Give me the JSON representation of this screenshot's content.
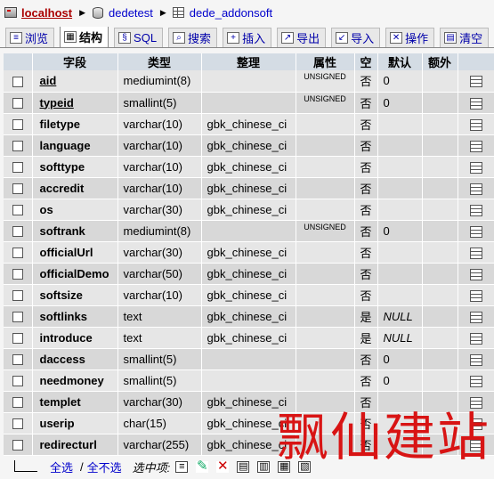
{
  "breadcrumb": {
    "server": "localhost",
    "database": "dedetest",
    "table": "dede_addonsoft"
  },
  "tabs": [
    {
      "label": "浏览",
      "icon": "browse-icon"
    },
    {
      "label": "结构",
      "icon": "structure-icon",
      "active": true
    },
    {
      "label": "SQL",
      "icon": "sql-icon"
    },
    {
      "label": "搜索",
      "icon": "search-icon"
    },
    {
      "label": "插入",
      "icon": "insert-icon"
    },
    {
      "label": "导出",
      "icon": "export-icon"
    },
    {
      "label": "导入",
      "icon": "import-icon"
    },
    {
      "label": "操作",
      "icon": "operations-icon"
    },
    {
      "label": "清空",
      "icon": "empty-icon"
    }
  ],
  "table": {
    "headers": [
      "字段",
      "类型",
      "整理",
      "属性",
      "空",
      "默认",
      "额外"
    ],
    "rows": [
      {
        "field": "aid",
        "type": "mediumint(8)",
        "collation": "",
        "attributes": "UNSIGNED",
        "null": "否",
        "default": "0",
        "extra": ""
      },
      {
        "field": "typeid",
        "type": "smallint(5)",
        "collation": "",
        "attributes": "UNSIGNED",
        "null": "否",
        "default": "0",
        "extra": ""
      },
      {
        "field": "filetype",
        "type": "varchar(10)",
        "collation": "gbk_chinese_ci",
        "attributes": "",
        "null": "否",
        "default": "",
        "extra": ""
      },
      {
        "field": "language",
        "type": "varchar(10)",
        "collation": "gbk_chinese_ci",
        "attributes": "",
        "null": "否",
        "default": "",
        "extra": ""
      },
      {
        "field": "softtype",
        "type": "varchar(10)",
        "collation": "gbk_chinese_ci",
        "attributes": "",
        "null": "否",
        "default": "",
        "extra": ""
      },
      {
        "field": "accredit",
        "type": "varchar(10)",
        "collation": "gbk_chinese_ci",
        "attributes": "",
        "null": "否",
        "default": "",
        "extra": ""
      },
      {
        "field": "os",
        "type": "varchar(30)",
        "collation": "gbk_chinese_ci",
        "attributes": "",
        "null": "否",
        "default": "",
        "extra": ""
      },
      {
        "field": "softrank",
        "type": "mediumint(8)",
        "collation": "",
        "attributes": "UNSIGNED",
        "null": "否",
        "default": "0",
        "extra": ""
      },
      {
        "field": "officialUrl",
        "type": "varchar(30)",
        "collation": "gbk_chinese_ci",
        "attributes": "",
        "null": "否",
        "default": "",
        "extra": ""
      },
      {
        "field": "officialDemo",
        "type": "varchar(50)",
        "collation": "gbk_chinese_ci",
        "attributes": "",
        "null": "否",
        "default": "",
        "extra": ""
      },
      {
        "field": "softsize",
        "type": "varchar(10)",
        "collation": "gbk_chinese_ci",
        "attributes": "",
        "null": "否",
        "default": "",
        "extra": ""
      },
      {
        "field": "softlinks",
        "type": "text",
        "collation": "gbk_chinese_ci",
        "attributes": "",
        "null": "是",
        "default": "NULL",
        "extra": ""
      },
      {
        "field": "introduce",
        "type": "text",
        "collation": "gbk_chinese_ci",
        "attributes": "",
        "null": "是",
        "default": "NULL",
        "extra": ""
      },
      {
        "field": "daccess",
        "type": "smallint(5)",
        "collation": "",
        "attributes": "",
        "null": "否",
        "default": "0",
        "extra": ""
      },
      {
        "field": "needmoney",
        "type": "smallint(5)",
        "collation": "",
        "attributes": "",
        "null": "否",
        "default": "0",
        "extra": ""
      },
      {
        "field": "templet",
        "type": "varchar(30)",
        "collation": "gbk_chinese_ci",
        "attributes": "",
        "null": "否",
        "default": "",
        "extra": ""
      },
      {
        "field": "userip",
        "type": "char(15)",
        "collation": "gbk_chinese_ci",
        "attributes": "",
        "null": "否",
        "default": "",
        "extra": ""
      },
      {
        "field": "redirecturl",
        "type": "varchar(255)",
        "collation": "gbk_chinese_ci",
        "attributes": "",
        "null": "否",
        "default": "",
        "extra": ""
      }
    ]
  },
  "footer": {
    "check_all": "全选",
    "separator": "/",
    "uncheck_all": "全不选",
    "with_selected": "选中项:"
  },
  "watermark": "飘仙建站"
}
